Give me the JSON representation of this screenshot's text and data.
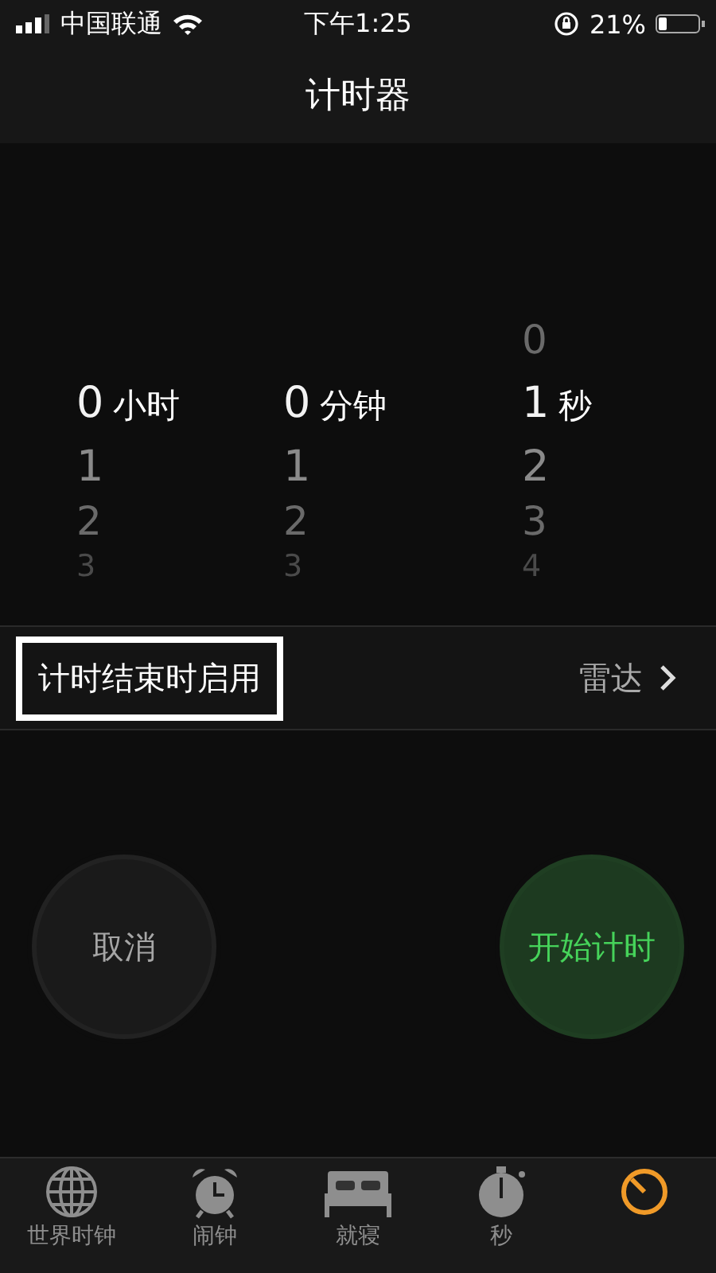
{
  "status_bar": {
    "carrier": "中国联通",
    "time": "下午1:25",
    "battery": "21%"
  },
  "title": "计时器",
  "picker": [
    {
      "value": "0",
      "unit": "小时",
      "below": [
        "1",
        "2",
        "3"
      ]
    },
    {
      "value": "0",
      "unit": "分钟",
      "below": [
        "1",
        "2",
        "3"
      ]
    },
    {
      "above": [
        "0"
      ],
      "value": "1",
      "unit": "秒",
      "below": [
        "2",
        "3",
        "4"
      ]
    }
  ],
  "end_row": {
    "label": "计时结束时启用",
    "value": "雷达",
    "highlighted": true
  },
  "buttons": [
    {
      "label": "取消",
      "kind": "cancel"
    },
    {
      "label": "开始计时",
      "kind": "start"
    }
  ],
  "tabs": [
    {
      "label": "世界时钟",
      "kind": "globe",
      "selected": false
    },
    {
      "label": "闹钟",
      "kind": "alarm",
      "selected": false
    },
    {
      "label": "就寝",
      "kind": "bed",
      "selected": false
    },
    {
      "label": "秒",
      "kind": "stopwatch",
      "selected": false
    },
    {
      "kind": "timer",
      "selected": true
    }
  ]
}
